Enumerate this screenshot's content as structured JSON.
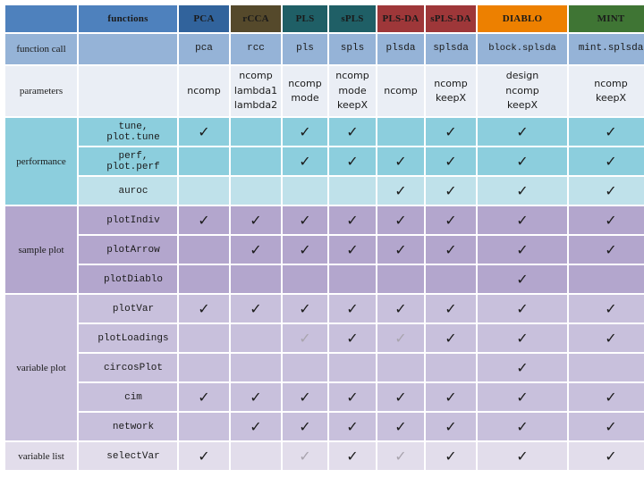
{
  "table": {
    "header": {
      "blank_label": "",
      "functions_label": "functions",
      "methods": [
        {
          "name": "PCA",
          "color": "#31639c"
        },
        {
          "name": "rCCA",
          "color": "#55492b"
        },
        {
          "name": "PLS",
          "color": "#1f5f66"
        },
        {
          "name": "sPLS",
          "color": "#1f5f66"
        },
        {
          "name": "PLS-DA",
          "color": "#9e3739"
        },
        {
          "name": "sPLS-DA",
          "color": "#9e3739"
        },
        {
          "name": "DIABLO",
          "color": "#ed8000"
        },
        {
          "name": "MINT",
          "color": "#3f7534"
        }
      ]
    },
    "rows": [
      {
        "section": "function call",
        "label": "",
        "style": "call",
        "cells": [
          "pca",
          "rcc",
          "pls",
          "spls",
          "plsda",
          "splsda",
          "block.splsda",
          "mint.splsda"
        ]
      },
      {
        "section": "parameters",
        "label": "",
        "style": "param",
        "cells": [
          "ncomp",
          "ncomp\nlambda1\nlambda2",
          "ncomp\nmode",
          "ncomp\nmode\nkeepX",
          "ncomp",
          "ncomp\nkeepX",
          "design\nncomp\nkeepX",
          "ncomp\nkeepX"
        ]
      },
      {
        "section": "performance",
        "label": "tune, plot.tune",
        "style": "perf",
        "checks": [
          "yes",
          "no",
          "yes",
          "yes",
          "no",
          "yes",
          "yes",
          "yes"
        ]
      },
      {
        "section": "performance",
        "label": "perf, plot.perf",
        "style": "perf",
        "checks": [
          "no",
          "no",
          "yes",
          "yes",
          "yes",
          "yes",
          "yes",
          "yes"
        ]
      },
      {
        "section": "performance",
        "label": "auroc",
        "style": "perf-light",
        "checks": [
          "no",
          "no",
          "no",
          "no",
          "yes",
          "yes",
          "yes",
          "yes"
        ]
      },
      {
        "section": "sample plot",
        "label": "plotIndiv",
        "style": "sample",
        "checks": [
          "yes",
          "yes",
          "yes",
          "yes",
          "yes",
          "yes",
          "yes",
          "yes"
        ]
      },
      {
        "section": "sample plot",
        "label": "plotArrow",
        "style": "sample",
        "checks": [
          "no",
          "yes",
          "yes",
          "yes",
          "yes",
          "yes",
          "yes",
          "yes"
        ]
      },
      {
        "section": "sample plot",
        "label": "plotDiablo",
        "style": "sample",
        "checks": [
          "no",
          "no",
          "no",
          "no",
          "no",
          "no",
          "yes",
          "no"
        ]
      },
      {
        "section": "variable plot",
        "label": "plotVar",
        "style": "var",
        "checks": [
          "yes",
          "yes",
          "yes",
          "yes",
          "yes",
          "yes",
          "yes",
          "yes"
        ]
      },
      {
        "section": "variable plot",
        "label": "plotLoadings",
        "style": "var",
        "checks": [
          "no",
          "no",
          "faded",
          "yes",
          "faded",
          "yes",
          "yes",
          "yes"
        ]
      },
      {
        "section": "variable plot",
        "label": "circosPlot",
        "style": "var",
        "checks": [
          "no",
          "no",
          "no",
          "no",
          "no",
          "no",
          "yes",
          "no"
        ]
      },
      {
        "section": "variable plot",
        "label": "cim",
        "style": "var",
        "checks": [
          "yes",
          "yes",
          "yes",
          "yes",
          "yes",
          "yes",
          "yes",
          "yes"
        ]
      },
      {
        "section": "variable plot",
        "label": "network",
        "style": "var",
        "checks": [
          "no",
          "yes",
          "yes",
          "yes",
          "yes",
          "yes",
          "yes",
          "yes"
        ]
      },
      {
        "section": "variable list",
        "label": "selectVar",
        "style": "list",
        "checks": [
          "yes",
          "no",
          "faded",
          "yes",
          "faded",
          "yes",
          "yes",
          "yes"
        ]
      }
    ],
    "section_labels": {
      "function_call": "function call",
      "parameters": "parameters",
      "performance": "performance",
      "sample_plot": "sample plot",
      "variable_plot": "variable plot",
      "variable_list": "variable list"
    },
    "check_glyph": "✓"
  }
}
